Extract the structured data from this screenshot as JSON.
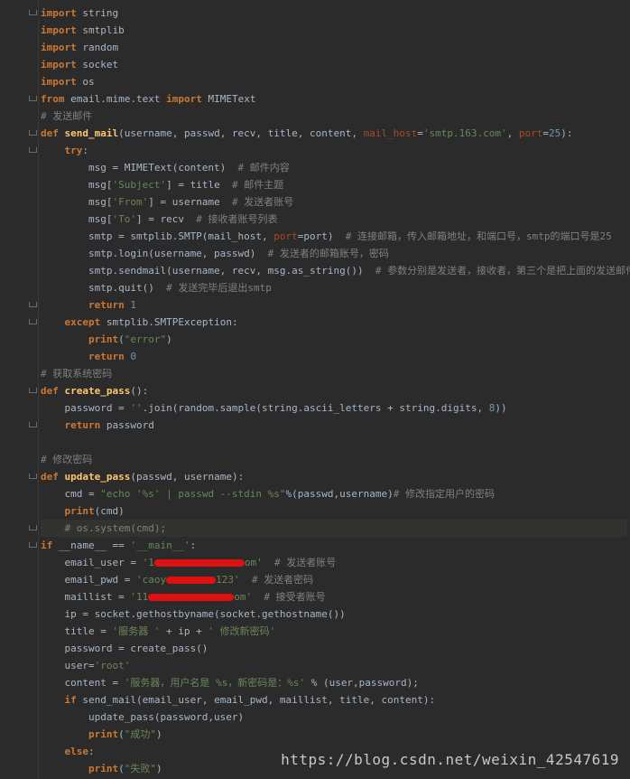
{
  "editor": {
    "lines": [
      "import string",
      "import smtplib",
      "import random",
      "import socket",
      "import os",
      "from email.mime.text import MIMEText",
      "# 发送邮件",
      "def send_mail(username, passwd, recv, title, content, mail_host='smtp.163.com', port=25):",
      "    try:",
      "        msg = MIMEText(content)  # 邮件内容",
      "        msg['Subject'] = title  # 邮件主题",
      "        msg['From'] = username  # 发送者账号",
      "        msg['To'] = recv  # 接收者账号列表",
      "        smtp = smtplib.SMTP(mail_host, port=port)  # 连接邮箱，传入邮箱地址，和端口号，smtp的端口号是25",
      "        smtp.login(username, passwd)  # 发送者的邮箱账号，密码",
      "        smtp.sendmail(username, recv, msg.as_string())  # 参数分别是发送者，接收者，第三个是把上面的发送邮件的",
      "        smtp.quit()  # 发送完毕后退出smtp",
      "        return 1",
      "    except smtplib.SMTPException:",
      "        print(\"error\")",
      "        return 0",
      "# 获取系统密码",
      "def create_pass():",
      "    password = ''.join(random.sample(string.ascii_letters + string.digits, 8))",
      "    return password",
      "",
      "# 修改密码",
      "def update_pass(passwd, username):",
      "    cmd = \"echo '%s' | passwd --stdin %s\"%(passwd,username)# 修改指定用户的密码",
      "    print(cmd)",
      "    # os.system(cmd);",
      "if __name__ == '__main__':",
      "    email_user = '1         @163.com'  # 发送者账号",
      "    email_pwd = 'caoy     123'  # 发送者密码",
      "    maillist = '11           om'  # 接受者账号",
      "    ip = socket.gethostbyname(socket.gethostname())",
      "    title = '服务器 ' + ip + ' 修改新密码'",
      "    password = create_pass()",
      "    user='root'",
      "    content = '服务器，用户名是 %s，新密码是：%s' % (user,password);",
      "    if send_mail(email_user, email_pwd, maillist, title, content):",
      "        update_pass(password,user)",
      "        print(\"成功\")",
      "    else:",
      "        print(\"失败\")"
    ],
    "watermark": "https://blog.csdn.net/weixin_42547619"
  }
}
